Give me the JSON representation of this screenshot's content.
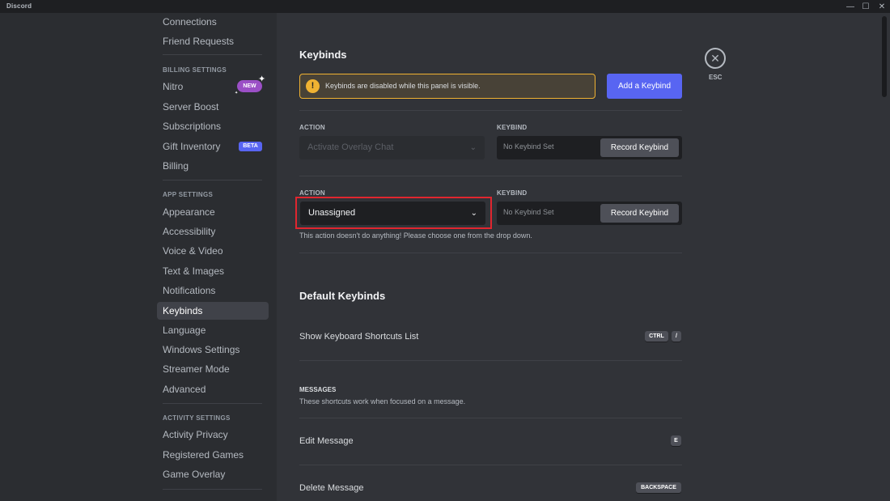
{
  "window": {
    "title": "Discord",
    "controls": [
      "—",
      "☐",
      "✕"
    ]
  },
  "sidebar": {
    "items": [
      {
        "label": "Connections"
      },
      {
        "label": "Friend Requests"
      },
      {
        "label": "Nitro"
      },
      {
        "label": "Server Boost"
      },
      {
        "label": "Subscriptions"
      },
      {
        "label": "Gift Inventory"
      },
      {
        "label": "Billing"
      },
      {
        "label": "Appearance"
      },
      {
        "label": "Accessibility"
      },
      {
        "label": "Voice & Video"
      },
      {
        "label": "Text & Images"
      },
      {
        "label": "Notifications"
      },
      {
        "label": "Keybinds"
      },
      {
        "label": "Language"
      },
      {
        "label": "Windows Settings"
      },
      {
        "label": "Streamer Mode"
      },
      {
        "label": "Advanced"
      },
      {
        "label": "Activity Privacy"
      },
      {
        "label": "Registered Games"
      },
      {
        "label": "Game Overlay"
      }
    ],
    "headers": {
      "billing": "BILLING SETTINGS",
      "app": "APP SETTINGS",
      "activity": "ACTIVITY SETTINGS"
    },
    "badges": {
      "new": "NEW",
      "beta": "BETA"
    },
    "active_item": "Keybinds"
  },
  "main": {
    "title": "Keybinds",
    "notice": {
      "icon": "!",
      "text": "Keybinds are disabled while this panel is visible."
    },
    "add_button": "Add a Keybind",
    "keybind_rows": [
      {
        "action_label": "ACTION",
        "keybind_label": "KEYBIND",
        "action_value": "Activate Overlay Chat",
        "keybind_value": "No Keybind Set",
        "record_label": "Record Keybind",
        "disabled": true
      },
      {
        "action_label": "ACTION",
        "keybind_label": "KEYBIND",
        "action_value": "Unassigned",
        "keybind_value": "No Keybind Set",
        "record_label": "Record Keybind",
        "disabled": false,
        "help": "This action doesn't do anything! Please choose one from the drop down."
      }
    ],
    "default_keybinds": {
      "title": "Default Keybinds",
      "show_shortcuts": {
        "label": "Show Keyboard Shortcuts List",
        "keys": [
          "CTRL",
          "/"
        ]
      },
      "messages": {
        "header": "MESSAGES",
        "desc": "These shortcuts work when focused on a message."
      },
      "edit_message": {
        "label": "Edit Message",
        "keys": [
          "E"
        ]
      },
      "delete_message": {
        "label": "Delete Message",
        "keys": [
          "BACKSPACE"
        ]
      }
    },
    "close": {
      "icon": "✕",
      "label": "ESC"
    }
  },
  "colors": {
    "accent": "#5865f2",
    "highlight": "#e0262f",
    "warning": "#f0b232",
    "nitro_badge": "#9b4fc6"
  }
}
